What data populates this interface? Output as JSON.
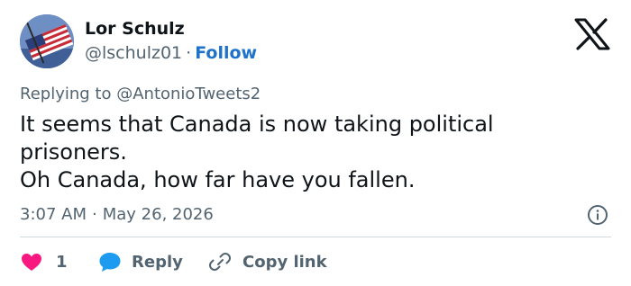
{
  "author": {
    "name": "Lor Schulz",
    "handle": "@lschulz01",
    "separator": "·",
    "follow_label": "Follow"
  },
  "reply_context": {
    "prefix": "Replying to",
    "target": "@AntonioTweets2"
  },
  "tweet": {
    "lines": [
      "It seems that Canada is now taking political",
      "prisoners.",
      "Oh Canada, how far have you fallen."
    ]
  },
  "meta": {
    "time": "3:07 AM",
    "separator": "·",
    "date": "May 26, 2026"
  },
  "actions": {
    "like_count": "1",
    "reply_label": "Reply",
    "copy_link_label": "Copy link"
  },
  "colors": {
    "like": "#f91880",
    "reply": "#1d9bf0",
    "follow": "#1d72c9",
    "secondary_text": "#536471"
  },
  "icons": {
    "brand": "x-logo-icon",
    "info": "info-icon",
    "like": "heart-icon",
    "reply": "speech-bubble-icon",
    "copy_link": "link-icon"
  }
}
